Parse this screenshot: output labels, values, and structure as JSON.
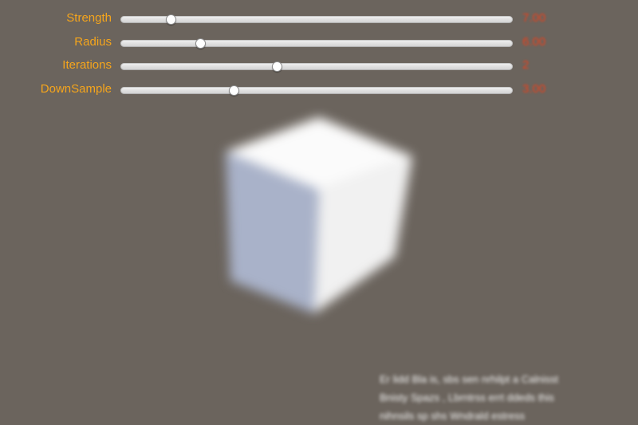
{
  "sliders": [
    {
      "label": "Strength",
      "value_text": "7.00",
      "value": 0.13
    },
    {
      "label": "Radius",
      "value_text": "6.00",
      "value": 0.205
    },
    {
      "label": "Iterations",
      "value_text": "2",
      "value": 0.4
    },
    {
      "label": "DownSample",
      "value_text": "3.00",
      "value": 0.29
    }
  ],
  "info_text": "Er lidd Bla is, sbs sen nrhilpt a Calnisst\nBnisty Spazs , Lbrntrss errt ddeds this\nnihnsils sp shs Wndrald estress"
}
